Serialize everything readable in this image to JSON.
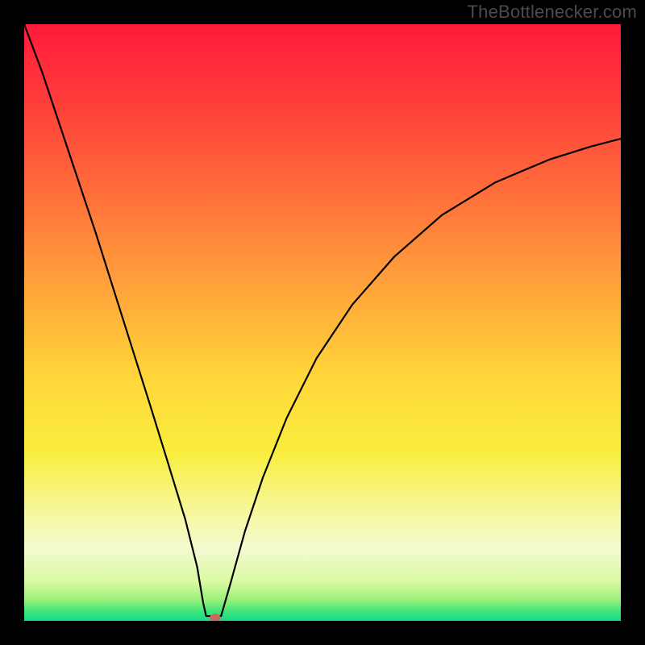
{
  "watermark": "TheBottlenecker.com",
  "chart_data": {
    "type": "line",
    "title": "",
    "xlabel": "",
    "ylabel": "",
    "xlim": [
      0,
      1
    ],
    "ylim": [
      0,
      1
    ],
    "optimum_x": 0.31,
    "marker": {
      "x": 0.32,
      "y": 0.005,
      "color": "#c96a5d"
    },
    "gradient_stops": [
      {
        "offset": 0.0,
        "color": "#ff1a3a"
      },
      {
        "offset": 0.12,
        "color": "#ff3a3a"
      },
      {
        "offset": 0.28,
        "color": "#ff6d3a"
      },
      {
        "offset": 0.45,
        "color": "#ffa63a"
      },
      {
        "offset": 0.6,
        "color": "#ffd83a"
      },
      {
        "offset": 0.72,
        "color": "#f9ee3f"
      },
      {
        "offset": 0.82,
        "color": "#f6f7a0"
      },
      {
        "offset": 0.88,
        "color": "#f3fad0"
      },
      {
        "offset": 0.935,
        "color": "#d8faa0"
      },
      {
        "offset": 0.965,
        "color": "#98f07a"
      },
      {
        "offset": 0.985,
        "color": "#3de57a"
      },
      {
        "offset": 1.0,
        "color": "#14db8c"
      }
    ],
    "curve_left": [
      {
        "x": 0.0,
        "y": 1.0
      },
      {
        "x": 0.03,
        "y": 0.92
      },
      {
        "x": 0.06,
        "y": 0.83
      },
      {
        "x": 0.09,
        "y": 0.74
      },
      {
        "x": 0.12,
        "y": 0.65
      },
      {
        "x": 0.15,
        "y": 0.555
      },
      {
        "x": 0.18,
        "y": 0.46
      },
      {
        "x": 0.21,
        "y": 0.365
      },
      {
        "x": 0.24,
        "y": 0.268
      },
      {
        "x": 0.27,
        "y": 0.17
      },
      {
        "x": 0.29,
        "y": 0.09
      },
      {
        "x": 0.3,
        "y": 0.03
      },
      {
        "x": 0.305,
        "y": 0.008
      }
    ],
    "curve_flat": [
      {
        "x": 0.305,
        "y": 0.008
      },
      {
        "x": 0.33,
        "y": 0.008
      }
    ],
    "curve_right": [
      {
        "x": 0.33,
        "y": 0.008
      },
      {
        "x": 0.345,
        "y": 0.06
      },
      {
        "x": 0.37,
        "y": 0.15
      },
      {
        "x": 0.4,
        "y": 0.24
      },
      {
        "x": 0.44,
        "y": 0.34
      },
      {
        "x": 0.49,
        "y": 0.44
      },
      {
        "x": 0.55,
        "y": 0.53
      },
      {
        "x": 0.62,
        "y": 0.61
      },
      {
        "x": 0.7,
        "y": 0.68
      },
      {
        "x": 0.79,
        "y": 0.735
      },
      {
        "x": 0.88,
        "y": 0.773
      },
      {
        "x": 0.95,
        "y": 0.795
      },
      {
        "x": 1.0,
        "y": 0.808
      }
    ]
  }
}
